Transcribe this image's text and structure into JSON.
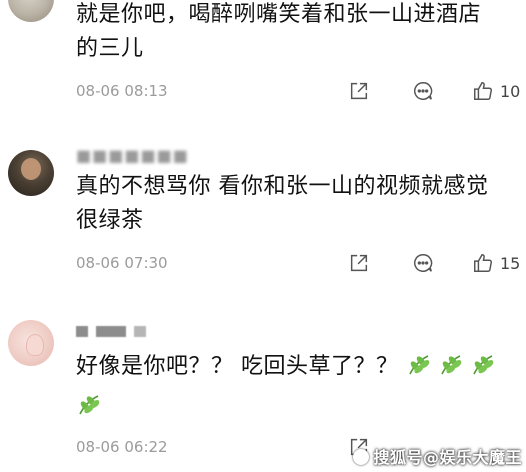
{
  "comments": [
    {
      "text_line1": "就是你吧，喝醉咧嘴笑着和张一山进酒店",
      "text_line2": "的三儿",
      "time": "08-06 08:13",
      "likes": "10"
    },
    {
      "text_line1": "真的不想骂你 看你和张一山的视频就感觉",
      "text_line2": "很绿茶",
      "time": "08-06 07:30",
      "likes": "15"
    },
    {
      "text_line1": "好像是你吧？？ 吃回头草了？？",
      "time": "08-06 06:22",
      "likes": ""
    }
  ],
  "watermark": "搜狐号@娱乐大魔王",
  "icons": {
    "share": "share-icon",
    "comment": "comment-icon",
    "like": "thumbs-up-icon",
    "emoji": "leaf-emoji-icon"
  },
  "colors": {
    "text": "#111111",
    "meta": "#9b9b9b",
    "leaf": "#5cae3c"
  }
}
